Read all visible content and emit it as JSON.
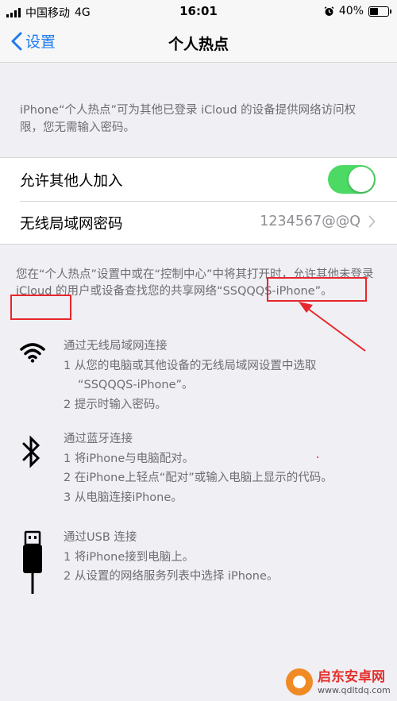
{
  "status_bar": {
    "carrier": "中国移动",
    "network": "4G",
    "time": "16:01",
    "battery_text": "40%",
    "battery_level": 0.4
  },
  "nav": {
    "back_label": "设置",
    "title": "个人热点"
  },
  "top_description": "iPhone“个人热点”可为其他已登录 iCloud 的设备提供网络访问权限，您无需输入密码。",
  "settings": {
    "allow_others_label": "允许其他人加入",
    "allow_others_on": true,
    "wifi_password_label": "无线局域网密码",
    "wifi_password_value": "1234567@@Q"
  },
  "note": {
    "text": "您在“个人热点”设置中或在“控制中心”中将其打开时，允许其他未登录 iCloud 的用户或设备查找您的共享网络“SSQQQS-iPhone”。"
  },
  "methods": {
    "wifi": {
      "title": "通过无线局域网连接",
      "step1_a": "1 从您的电脑或其他设备的无线局域网设置中选取",
      "step1_b": "“SSQQQS-iPhone”。",
      "step2": "2 提示时输入密码。"
    },
    "bluetooth": {
      "title": "通过蓝牙连接",
      "step1": "1 将iPhone与电脑配对。",
      "step2": "2 在iPhone上轻点“配对”或输入电脑上显示的代码。",
      "step3": "3 从电脑连接iPhone。"
    },
    "usb": {
      "title": "通过USB 连接",
      "step1": "1 将iPhone接到电脑上。",
      "step2": "2 从设置的网络服务列表中选择 iPhone。"
    }
  },
  "watermark": {
    "name": "启东安卓网",
    "url": "www.qdltdq.com"
  },
  "colors": {
    "accent": "#1f7bf0",
    "toggle_on": "#4cd964",
    "annotation": "#e8262c"
  },
  "icons": [
    "signal-icon",
    "alarm-icon",
    "battery-icon",
    "back-chevron-icon",
    "chevron-right-icon",
    "wifi-icon",
    "bluetooth-icon",
    "usb-icon"
  ]
}
